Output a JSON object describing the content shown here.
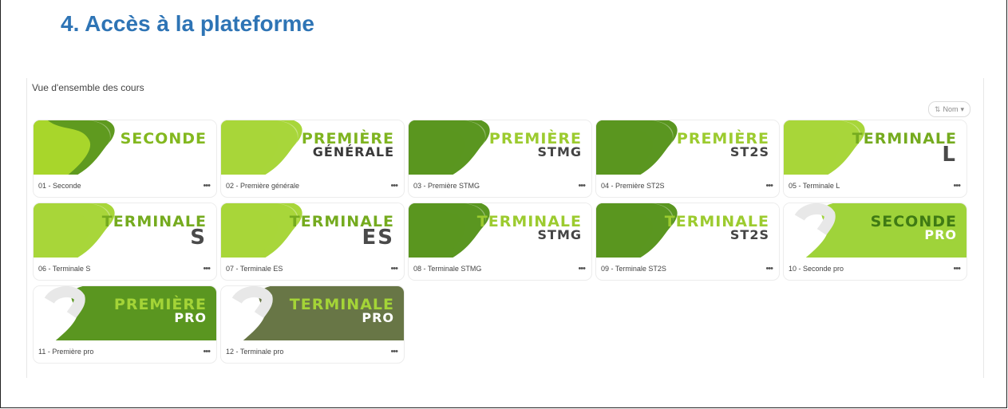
{
  "heading": "4.  Accès à la plateforme",
  "panel": {
    "title": "Vue d'ensemble des cours",
    "sort_label": "Nom",
    "sort_icon": "sort-icon",
    "sort_caret": "▾"
  },
  "more_label": "•••",
  "courses": [
    {
      "name": "01 - Seconde",
      "line1": "SECONDE",
      "line2": "",
      "style": "full",
      "bg": "#5f9a1f",
      "shape": "#b5e02e",
      "text1": "#83b81f",
      "text2": "#4a4a4a"
    },
    {
      "name": "02 - Première générale",
      "line1": "PREMIÈRE",
      "line2": "GÉNÉRALE",
      "style": "full",
      "bg": "#a8d63a",
      "shape": "#a8d63a",
      "text1": "#7fb420",
      "text2": "#3a3a3a"
    },
    {
      "name": "03 - Première STMG",
      "line1": "PREMIÈRE",
      "line2": "STMG",
      "style": "full",
      "bg": "#5a9620",
      "shape": "#5a9620",
      "text1": "#9ccb2f",
      "text2": "#444444"
    },
    {
      "name": "04 - Première ST2S",
      "line1": "PREMIÈRE",
      "line2": "ST2S",
      "style": "full",
      "bg": "#5a9620",
      "shape": "#5a9620",
      "text1": "#9ccb2f",
      "text2": "#444444"
    },
    {
      "name": "05 - Terminale L",
      "line1": "TERMINALE",
      "line2": "L",
      "style": "full",
      "bg": "#a8d63a",
      "shape": "#a8d63a",
      "text1": "#75ab1f",
      "text2": "#4a4a4a"
    },
    {
      "name": "06 - Terminale S",
      "line1": "TERMINALE",
      "line2": "S",
      "style": "full",
      "bg": "#a8d63a",
      "shape": "#a8d63a",
      "text1": "#75ab1f",
      "text2": "#4a4a4a"
    },
    {
      "name": "07 - Terminale ES",
      "line1": "TERMINALE",
      "line2": "ES",
      "style": "full",
      "bg": "#a8d63a",
      "shape": "#a8d63a",
      "text1": "#75ab1f",
      "text2": "#4a4a4a"
    },
    {
      "name": "08 - Terminale STMG",
      "line1": "TERMINALE",
      "line2": "STMG",
      "style": "full",
      "bg": "#5a9620",
      "shape": "#5a9620",
      "text1": "#9ccb2f",
      "text2": "#444444"
    },
    {
      "name": "09 - Terminale ST2S",
      "line1": "TERMINALE",
      "line2": "ST2S",
      "style": "full",
      "bg": "#5a9620",
      "shape": "#5a9620",
      "text1": "#9ccb2f",
      "text2": "#444444"
    },
    {
      "name": "10 - Seconde pro",
      "line1": "SECONDE",
      "line2": "PRO",
      "style": "pro",
      "bg": "#9fd33a",
      "shape": "#9fd33a",
      "text1": "#3f7a14",
      "text2": "#ffffff"
    },
    {
      "name": "11 - Première pro",
      "line1": "PREMIÈRE",
      "line2": "PRO",
      "style": "pro",
      "bg": "#5a9620",
      "shape": "#5a9620",
      "text1": "#a4d437",
      "text2": "#ffffff"
    },
    {
      "name": "12 - Terminale pro",
      "line1": "TERMINALE",
      "line2": "PRO",
      "style": "pro",
      "bg": "#687646",
      "shape": "#687646",
      "text1": "#a4d437",
      "text2": "#ffffff"
    }
  ]
}
